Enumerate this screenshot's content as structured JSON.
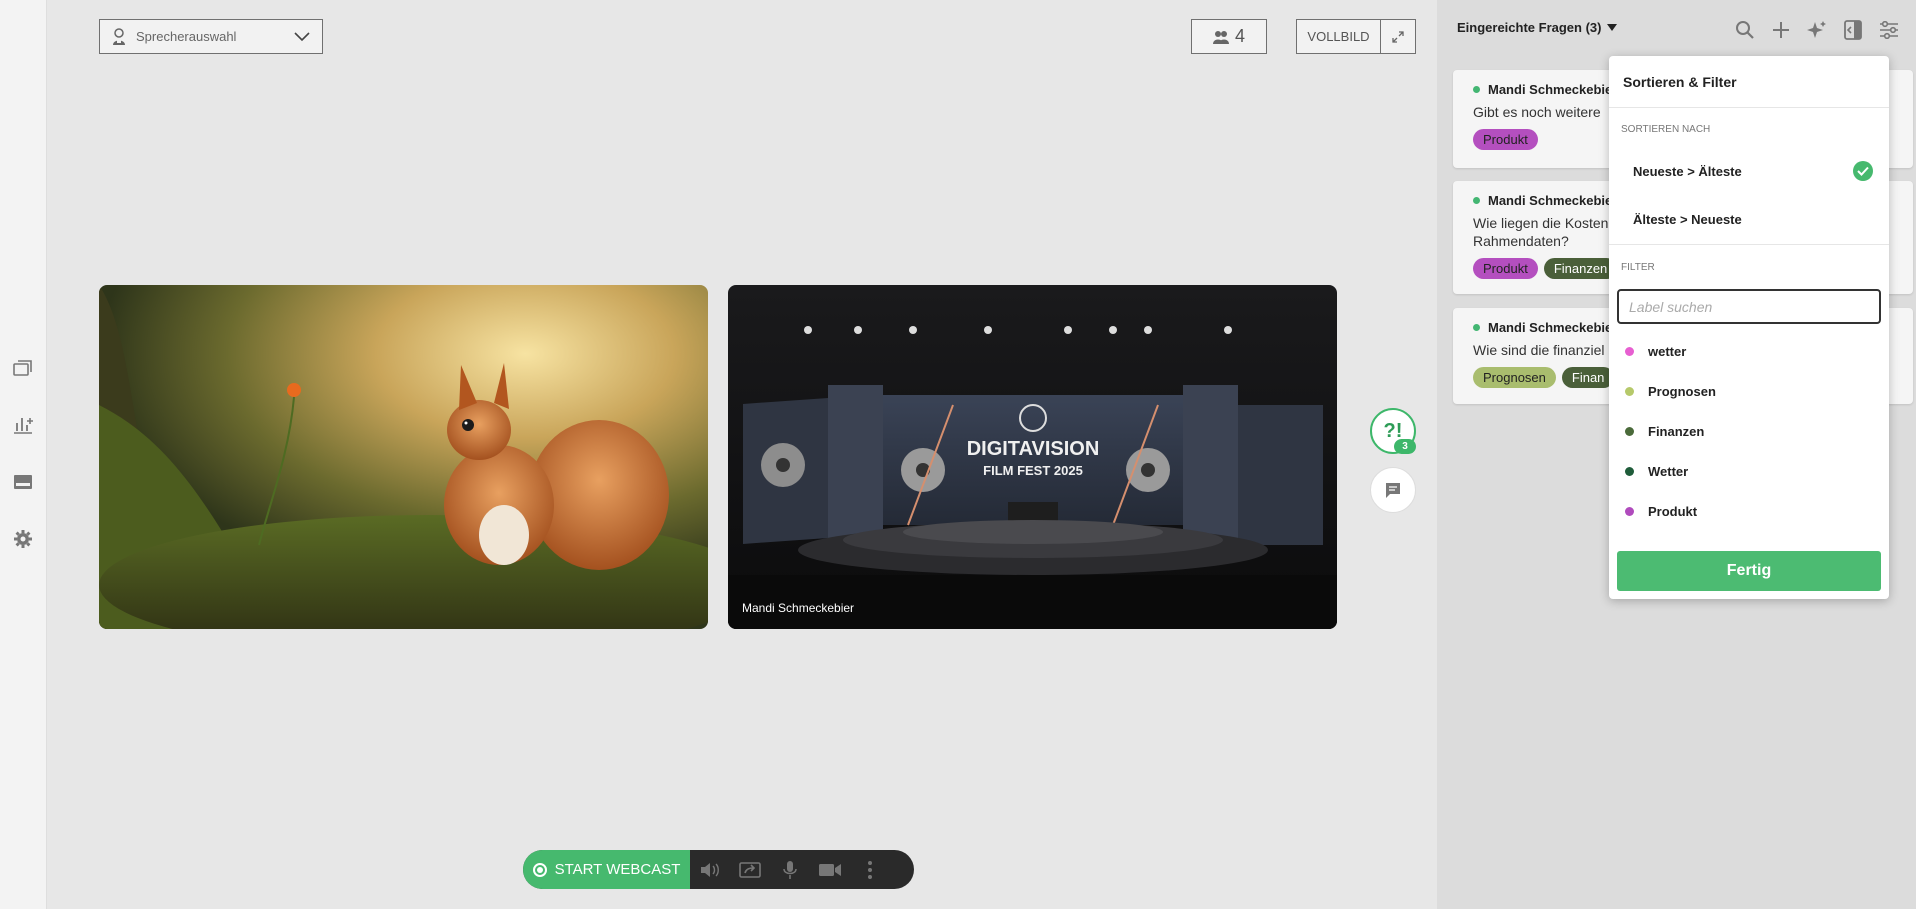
{
  "toolbar": {
    "speaker_select": "Sprecherauswahl",
    "participant_count": "4",
    "fullscreen_label": "VOLLBILD"
  },
  "tiles": [
    {
      "name": ""
    },
    {
      "name": "Mandi Schmeckebier",
      "stage_title_1": "DIGITAVISION",
      "stage_title_2": "FILM FEST 2025"
    }
  ],
  "side_buttons": {
    "qa_label": "?!",
    "qa_badge": "3"
  },
  "controls": {
    "webcast_label": "START WEBCAST"
  },
  "panel": {
    "title": "Eingereichte Fragen (3)",
    "questions": [
      {
        "author": "Mandi Schmeckebie",
        "text": "Gibt es noch weitere",
        "tags": [
          "Produkt"
        ]
      },
      {
        "author": "Mandi Schmeckebie",
        "text": "Wie liegen die Kosten Rahmendaten?",
        "tags": [
          "Produkt",
          "Finanzen"
        ]
      },
      {
        "author": "Mandi Schmeckebie",
        "text": "Wie sind die finanziel",
        "tags": [
          "Prognosen",
          "Finan"
        ]
      }
    ]
  },
  "dropdown": {
    "title": "Sortieren & Filter",
    "sort_heading": "SORTIEREN NACH",
    "sort_options": [
      "Neueste > Älteste",
      "Älteste > Neueste"
    ],
    "filter_heading": "FILTER",
    "search_placeholder": "Label suchen",
    "filters": [
      {
        "label": "wetter",
        "color": "#e75fd1"
      },
      {
        "label": "Prognosen",
        "color": "#b6c96a"
      },
      {
        "label": "Finanzen",
        "color": "#4a6a3a"
      },
      {
        "label": "Wetter",
        "color": "#1f5c3a"
      },
      {
        "label": "Produkt",
        "color": "#b04bbd"
      }
    ],
    "done_label": "Fertig"
  },
  "colors": {
    "accent": "#46b96e",
    "tag_produkt": "#b44fbf",
    "tag_finanzen": "#4a5f39",
    "tag_prognosen": "#a9bd6e"
  }
}
